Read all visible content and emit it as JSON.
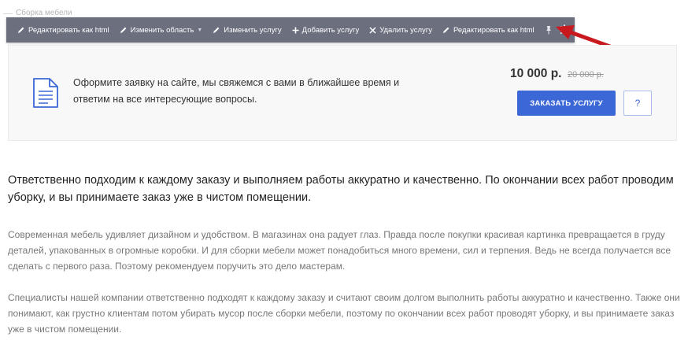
{
  "section": {
    "label": "Сборка мебели"
  },
  "toolbar": {
    "items": [
      {
        "label": "Редактировать как html",
        "icon": "pencil-icon"
      },
      {
        "label": "Изменить область",
        "icon": "pencil-icon",
        "has_dropdown": true
      },
      {
        "label": "Изменить услугу",
        "icon": "pencil-icon"
      },
      {
        "label": "Добавить услугу",
        "icon": "plus-icon"
      },
      {
        "label": "Удалить услугу",
        "icon": "close-icon"
      },
      {
        "label": "Редактировать как html",
        "icon": "pencil-icon"
      }
    ],
    "pin_icon": "pin-icon",
    "settings_icon": "gear-icon",
    "colors": {
      "background": "#6b6f7e",
      "text": "#ffffff"
    }
  },
  "annotation": {
    "arrow_color": "#c8191e"
  },
  "order": {
    "icon": "document-icon",
    "text": "Оформите заявку на сайте, мы свяжемся с вами в ближайшее время и ответим на все интересующие вопросы.",
    "price": "10 000 р.",
    "old_price": "20 000 р.",
    "button_label": "ЗАКАЗАТЬ УСЛУГУ",
    "question_label": "?",
    "accent": "#3b68d6"
  },
  "content": {
    "lead": "Ответственно подходим к каждому заказу и выполняем работы аккуратно и качественно. По окончании всех работ проводим уборку, и вы принимаете заказ уже в чистом помещении.",
    "paragraphs": [
      "Современная мебель удивляет дизайном и удобством. В магазинах она радует глаз. Правда после покупки красивая картинка превращается в груду деталей, упакованных в огромные коробки. И для сборки мебели может понадобиться много времени, сил и терпения. Ведь не всегда получается все сделать с первого раза. Поэтому рекомендуем поручить это дело мастерам.",
      "Специалисты нашей компании ответственно подходят к каждому заказу и считают своим долгом выполнить работы аккуратно и качественно. Также они понимают, как грустно клиентам потом убирать мусор после сборки мебели, поэтому по окончании всех работ проводят уборку, и вы принимаете заказ уже в чистом помещении."
    ]
  }
}
